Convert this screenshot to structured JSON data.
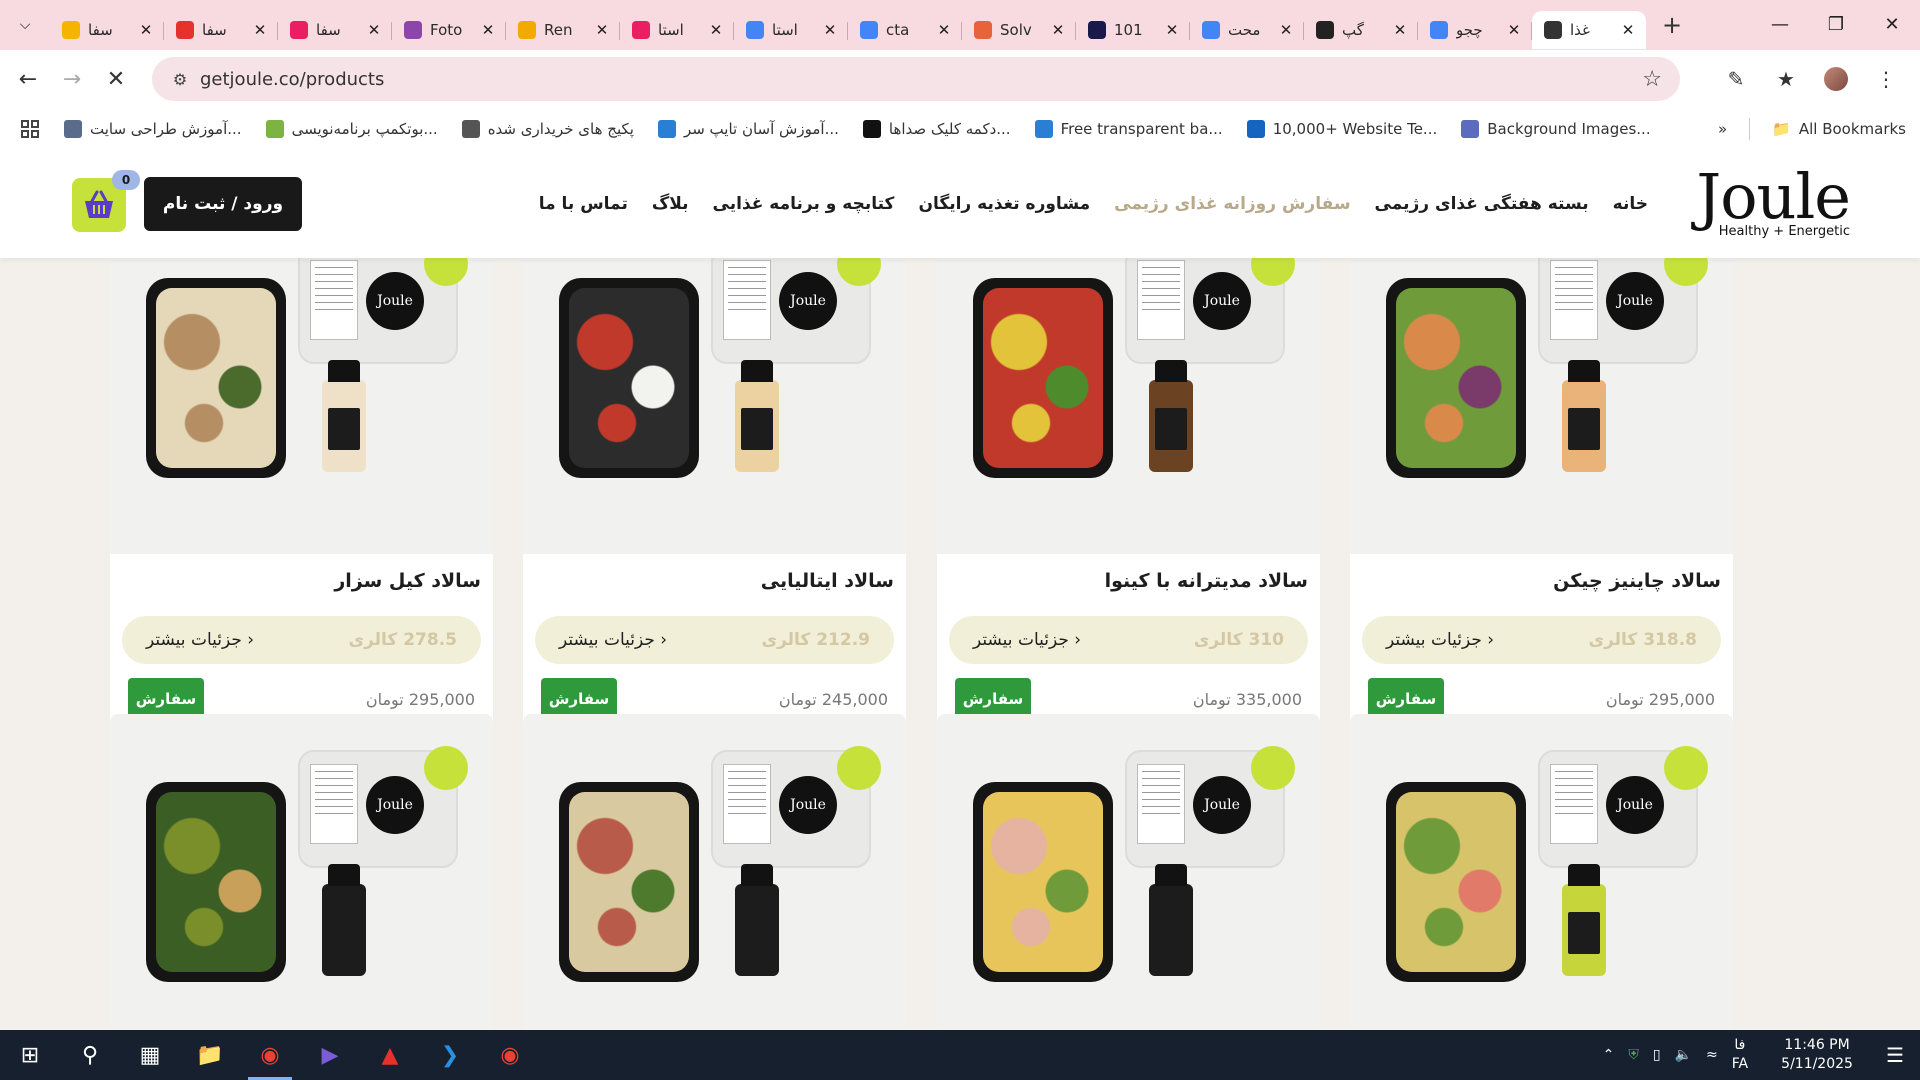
{
  "colors": {
    "tabstrip_bg": "#f8dbe1",
    "omnibox_bg": "#f5e3e7",
    "page_bg": "#f3f0eb",
    "accent_lime": "#c6e23a",
    "order_green": "#2e9a3c",
    "calorie_text": "#d3c7a4",
    "nav_active": "#b7a98a",
    "taskbar_bg": "#16202e"
  },
  "browser": {
    "tabs": [
      {
        "title": "سفا",
        "favicon": "shield-badge-icon",
        "color": "#f4b400"
      },
      {
        "title": "سفا",
        "favicon": "pdf-red-icon",
        "color": "#e5322d"
      },
      {
        "title": "سفا",
        "favicon": "circle-red-icon",
        "color": "#e91e63"
      },
      {
        "title": "Foto",
        "favicon": "fotor-icon",
        "color": "#8e44ad"
      },
      {
        "title": "Ren",
        "favicon": "book-icon",
        "color": "#f2a900"
      },
      {
        "title": "استا",
        "favicon": "exclamation-icon",
        "color": "#e91e63"
      },
      {
        "title": "استا",
        "favicon": "google-icon",
        "color": "#4285f4"
      },
      {
        "title": "cta",
        "favicon": "google-icon",
        "color": "#4285f4"
      },
      {
        "title": "Solv",
        "favicon": "solve-icon",
        "color": "#e8623a"
      },
      {
        "title": "101",
        "favicon": "ui-icon",
        "color": "#1a1a4a"
      },
      {
        "title": "محت",
        "favicon": "google-icon",
        "color": "#4285f4"
      },
      {
        "title": "گپ",
        "favicon": "chatgpt-icon",
        "color": "#222222"
      },
      {
        "title": "چجو",
        "favicon": "google-icon",
        "color": "#4285f4"
      },
      {
        "title": "غذا",
        "favicon": "joule-icon",
        "color": "#333333"
      }
    ],
    "url": "getjoule.co/products",
    "bookmarks": [
      {
        "label": "آموزش طراحی سایت...",
        "icon": "a-icon",
        "color": "#5b6b8c"
      },
      {
        "label": "بوتکمپ برنامه‌نویسی...",
        "icon": "leaf-icon",
        "color": "#7cb342"
      },
      {
        "label": "پکیج های خریداری شده",
        "icon": "network-icon",
        "color": "#555555"
      },
      {
        "label": "آموزش آسان تایپ سر...",
        "icon": "keyboard-icon",
        "color": "#2a7fd4"
      },
      {
        "label": "دکمه کلیک صداها...",
        "icon": "zs-icon",
        "color": "#111111"
      },
      {
        "label": "Free transparent ba...",
        "icon": "bookmark-blue-icon",
        "color": "#2a7fd4"
      },
      {
        "label": "10,000+ Website Te...",
        "icon": "n-icon",
        "color": "#1565c0"
      },
      {
        "label": "Background Images...",
        "icon": "star-icon",
        "color": "#5c6bc0"
      }
    ],
    "all_bookmarks": "All Bookmarks"
  },
  "site": {
    "logo": {
      "word": "Joule",
      "tagline": "Healthy + Energetic"
    },
    "nav": [
      {
        "label": "خانه",
        "active": false
      },
      {
        "label": "بسته هفتگی غذای رژیمی",
        "active": false
      },
      {
        "label": "سفارش روزانه غذای رژیمی",
        "active": true
      },
      {
        "label": "مشاوره تغذیه رایگان",
        "active": false
      },
      {
        "label": "کتابچه و برنامه غذایی",
        "active": false
      },
      {
        "label": "بلاگ",
        "active": false
      },
      {
        "label": "تماس با ما",
        "active": false
      }
    ],
    "login_label": "ورود / ثبت نام",
    "cart_count": "0"
  },
  "products": [
    {
      "title": "سالاد چاینیز چیکن",
      "calories": "318.8 کالری",
      "more": "جزئیات بیشتر",
      "price": "295,000 تومان",
      "order": "سفارش",
      "food_colors": [
        "#d98a4a",
        "#7a3b6b",
        "#6f9b3a"
      ],
      "bottle_color": "#e9b37a"
    },
    {
      "title": "سالاد مدیترانه با کینوا",
      "calories": "310 کالری",
      "more": "جزئیات بیشتر",
      "price": "335,000 تومان",
      "order": "سفارش",
      "food_colors": [
        "#e2c33a",
        "#4d8b2c",
        "#c0392b"
      ],
      "bottle_color": "#6b4322"
    },
    {
      "title": "سالاد ایتالیایی",
      "calories": "212.9 کالری",
      "more": "جزئیات بیشتر",
      "price": "245,000 تومان",
      "order": "سفارش",
      "food_colors": [
        "#c0392b",
        "#f2f2ee",
        "#2c2c2c"
      ],
      "bottle_color": "#ecd2a0"
    },
    {
      "title": "سالاد کیل سزار",
      "calories": "278.5 کالری",
      "more": "جزئیات بیشتر",
      "price": "295,000 تومان",
      "order": "سفارش",
      "food_colors": [
        "#b58e63",
        "#4a6b2c",
        "#e4d8b8"
      ],
      "bottle_color": "#efe0c8"
    },
    {
      "food_colors": [
        "#6f9b3a",
        "#e27a6a",
        "#d7c36a"
      ],
      "bottle_color": "#c6d63a"
    },
    {
      "food_colors": [
        "#e6b3a0",
        "#6f9b3a",
        "#e8c55a"
      ],
      "bottle_color": "#1c1c1c"
    },
    {
      "food_colors": [
        "#b85b4a",
        "#4d7a2c",
        "#d9c9a0"
      ],
      "bottle_color": "#1c1c1c"
    },
    {
      "food_colors": [
        "#7a8f2a",
        "#c9a05a",
        "#3b5e25"
      ],
      "bottle_color": "#1c1c1c"
    }
  ],
  "taskbar": {
    "apps": [
      "windows-start-icon",
      "search-icon",
      "task-view-icon",
      "file-explorer-icon",
      "chrome-icon",
      "visual-studio-icon",
      "acrobat-icon",
      "vscode-icon",
      "chrome-icon"
    ],
    "lang": "FA",
    "lang_top": "فا",
    "time": "11:46 PM",
    "date": "5/11/2025"
  }
}
